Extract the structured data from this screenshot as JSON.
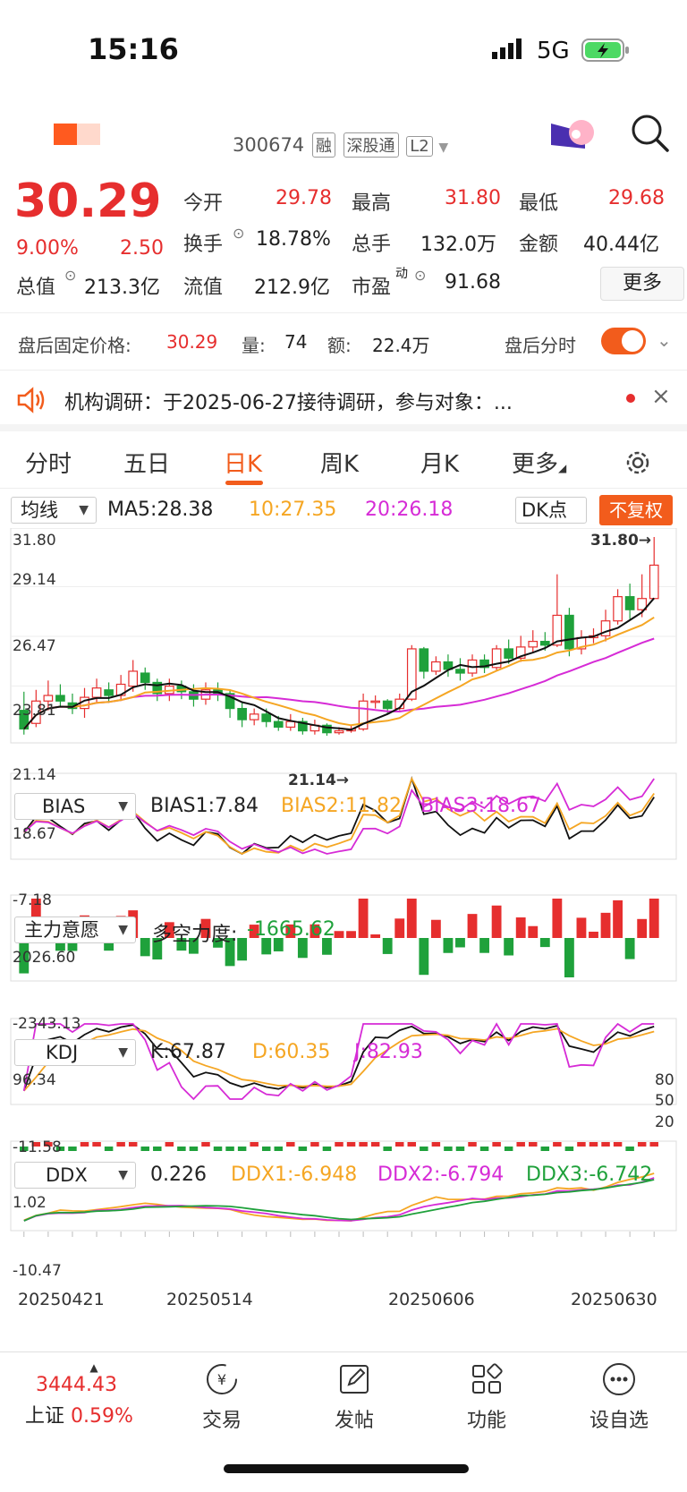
{
  "status_bar": {
    "time": "15:16",
    "network": "5G"
  },
  "header": {
    "code": "300674",
    "badges": [
      "融",
      "深股通",
      "L2"
    ]
  },
  "quote": {
    "price": "30.29",
    "change_pct": "9.00%",
    "change_amt": "2.50",
    "open_label": "今开",
    "open": "29.78",
    "high_label": "最高",
    "high": "31.80",
    "low_label": "最低",
    "low": "29.68",
    "turnover_label": "换手",
    "turnover": "18.78%",
    "volume_label": "总手",
    "volume": "132.0万",
    "amount_label": "金额",
    "amount": "40.44亿",
    "mcap_label": "总值",
    "mcap": "213.3亿",
    "float_label": "流值",
    "float": "212.9亿",
    "pe_label": "市盈",
    "pe_sup": "动",
    "pe": "91.68",
    "more_label": "更多"
  },
  "after_hours": {
    "label": "盘后固定价格:",
    "price": "30.29",
    "vol_label": "量:",
    "vol": "74",
    "amt_label": "额:",
    "amt": "22.4万",
    "toggle_label": "盘后分时"
  },
  "notice": {
    "text": "机构调研：于2025-06-27接待调研，参与对象：..."
  },
  "tabs": [
    "分时",
    "五日",
    "日K",
    "周K",
    "月K",
    "更多"
  ],
  "main_chart": {
    "indicator": "均线",
    "ma5": "MA5:28.38",
    "ma10": "10:27.35",
    "ma20": "20:26.18",
    "dk_label": "DK点",
    "adjust_label": "不复权",
    "y_labels": [
      "31.80",
      "29.14",
      "26.47",
      "23.81",
      "21.14"
    ],
    "max_marker": "31.80→",
    "min_marker": "21.14→"
  },
  "bias": {
    "name": "BIAS",
    "b1": "BIAS1:7.84",
    "b2": "BIAS2:11.82",
    "b3": "BIAS3:18.67",
    "ymax": "18.67",
    "ymin": "-7.18"
  },
  "zlyy": {
    "name": "主力意愿",
    "label": "多空力度:",
    "value": "-1665.62",
    "ymax": "2026.60",
    "ymin": "-2343.13"
  },
  "kdj": {
    "name": "KDJ",
    "k": "K:67.87",
    "d": "D:60.35",
    "j": "J:82.93",
    "ymax": "96.34",
    "ymin": "-11.58",
    "right_labels": [
      "80",
      "50",
      "20"
    ]
  },
  "ddx": {
    "name": "DDX",
    "v": "0.226",
    "d1": "DDX1:-6.948",
    "d2": "DDX2:-6.794",
    "d3": "DDX3:-6.742",
    "ymax": "1.02",
    "ymin": "-10.47"
  },
  "x_dates": [
    "20250421",
    "20250514",
    "20250606",
    "20250630"
  ],
  "bottom_nav": {
    "index_value": "3444.43",
    "index_name": "上证",
    "index_pct": "0.59%",
    "items": [
      {
        "label": "交易",
        "icon": "yen-exchange-icon"
      },
      {
        "label": "发帖",
        "icon": "edit-icon"
      },
      {
        "label": "功能",
        "icon": "grid-icon"
      },
      {
        "label": "设自选",
        "icon": "more-circle-icon"
      }
    ]
  },
  "chart_data": {
    "type": "line",
    "x": [
      "20250421",
      "20250514",
      "20250606",
      "20250630"
    ],
    "candles": [
      [
        22.5,
        21.5,
        23.5,
        21.2
      ],
      [
        21.8,
        23.0,
        23.6,
        21.6
      ],
      [
        23.0,
        23.3,
        24.1,
        22.5
      ],
      [
        23.3,
        23.0,
        23.9,
        22.7
      ],
      [
        22.9,
        22.6,
        23.4,
        22.3
      ],
      [
        22.6,
        23.2,
        23.7,
        22.1
      ],
      [
        23.2,
        23.7,
        24.2,
        22.9
      ],
      [
        23.6,
        23.3,
        24.0,
        22.9
      ],
      [
        23.3,
        23.9,
        24.4,
        23.0
      ],
      [
        23.8,
        24.6,
        25.2,
        23.5
      ],
      [
        24.5,
        24.0,
        24.8,
        23.6
      ],
      [
        24.0,
        23.4,
        24.2,
        23.0
      ],
      [
        23.4,
        23.8,
        24.2,
        23.0
      ],
      [
        23.8,
        23.5,
        24.1,
        23.1
      ],
      [
        23.5,
        23.1,
        23.9,
        22.7
      ],
      [
        23.1,
        23.6,
        24.0,
        22.8
      ],
      [
        23.6,
        23.4,
        24.0,
        23.0
      ],
      [
        23.4,
        22.6,
        23.6,
        22.1
      ],
      [
        22.6,
        22.0,
        22.9,
        21.6
      ],
      [
        22.0,
        22.3,
        22.6,
        21.7
      ],
      [
        22.3,
        21.9,
        22.6,
        21.6
      ],
      [
        21.9,
        21.6,
        22.2,
        21.4
      ],
      [
        21.6,
        21.9,
        22.3,
        21.4
      ],
      [
        21.9,
        21.4,
        22.1,
        21.2
      ],
      [
        21.4,
        21.7,
        22.0,
        21.2
      ],
      [
        21.7,
        21.3,
        21.8,
        21.14
      ],
      [
        21.3,
        21.4,
        21.6,
        21.2
      ],
      [
        21.4,
        21.5,
        21.7,
        21.3
      ],
      [
        21.5,
        23.0,
        23.4,
        21.4
      ],
      [
        23.0,
        23.0,
        23.3,
        22.6
      ],
      [
        23.0,
        22.6,
        23.1,
        22.3
      ],
      [
        22.6,
        23.1,
        23.4,
        22.5
      ],
      [
        23.1,
        25.8,
        26.0,
        23.0
      ],
      [
        25.8,
        24.6,
        25.9,
        24.2
      ],
      [
        24.6,
        25.1,
        25.4,
        24.4
      ],
      [
        25.1,
        24.7,
        25.5,
        24.3
      ],
      [
        24.7,
        24.5,
        25.3,
        24.1
      ],
      [
        24.5,
        25.2,
        25.5,
        24.3
      ],
      [
        25.2,
        24.8,
        25.5,
        24.5
      ],
      [
        24.8,
        25.8,
        26.0,
        24.6
      ],
      [
        25.8,
        25.3,
        26.3,
        25.0
      ],
      [
        25.3,
        25.9,
        26.5,
        25.1
      ],
      [
        25.9,
        26.2,
        26.8,
        25.6
      ],
      [
        26.2,
        26.0,
        26.7,
        25.7
      ],
      [
        26.0,
        27.6,
        29.8,
        25.9
      ],
      [
        27.6,
        25.8,
        28.0,
        25.4
      ],
      [
        25.8,
        26.4,
        26.8,
        25.5
      ],
      [
        26.4,
        26.5,
        26.9,
        26.1
      ],
      [
        26.5,
        27.3,
        27.9,
        26.2
      ],
      [
        27.3,
        28.6,
        29.0,
        27.1
      ],
      [
        28.6,
        27.9,
        29.3,
        27.4
      ],
      [
        27.9,
        28.5,
        29.8,
        27.5
      ],
      [
        28.5,
        30.29,
        31.8,
        29.68
      ]
    ],
    "ma5": "28.38",
    "ma10": "27.35",
    "ma20": "26.18",
    "ylim": [
      21.14,
      31.8
    ]
  }
}
